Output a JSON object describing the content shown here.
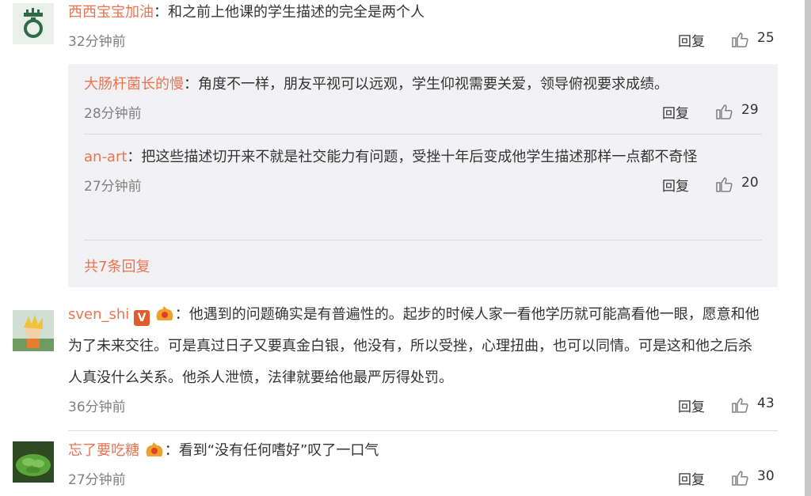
{
  "comments": [
    {
      "user": "西西宝宝加油",
      "sep": "：",
      "text": "和之前上他课的学生描述的完全是两个人",
      "time": "32分钟前",
      "likes": "25"
    },
    {
      "user": "sven_shi",
      "sep": "：",
      "text": "他遇到的问题确实是有普遍性的。起步的时候人家一看他学历就可能高看他一眼，愿意和他为了未来交往。可是真过日子又要真金白银，他没有，所以受挫，心理扭曲，也可以同情。可是这和他之后杀人真没什么关系。他杀人泄愤，法律就要给他最严厉得处罚。",
      "time": "36分钟前",
      "likes": "43"
    },
    {
      "user": "忘了要吃糖",
      "sep": "：",
      "text": "看到“没有任何嗜好”叹了一口气",
      "time": "27分钟前",
      "likes": "30"
    }
  ],
  "replies": [
    {
      "user": "大肠杆菌长的慢",
      "sep": "：",
      "text": "角度不一样，朋友平视可以远观，学生仰视需要关爱，领导俯视要求成绩。",
      "time": "28分钟前",
      "likes": "29"
    },
    {
      "user": "an-art",
      "sep": "：",
      "text": "把这些描述切开来不就是社交能力有问题，受挫十年后变成他学生描述那样一点都不奇怪",
      "time": "27分钟前",
      "likes": "20"
    }
  ],
  "ui": {
    "reply_label": "回复",
    "more_replies": "共7条回复",
    "verified_badge": "V"
  },
  "colors": {
    "username": "#eb7350",
    "meta": "#808080",
    "reply_bg": "#f2f2f5"
  }
}
